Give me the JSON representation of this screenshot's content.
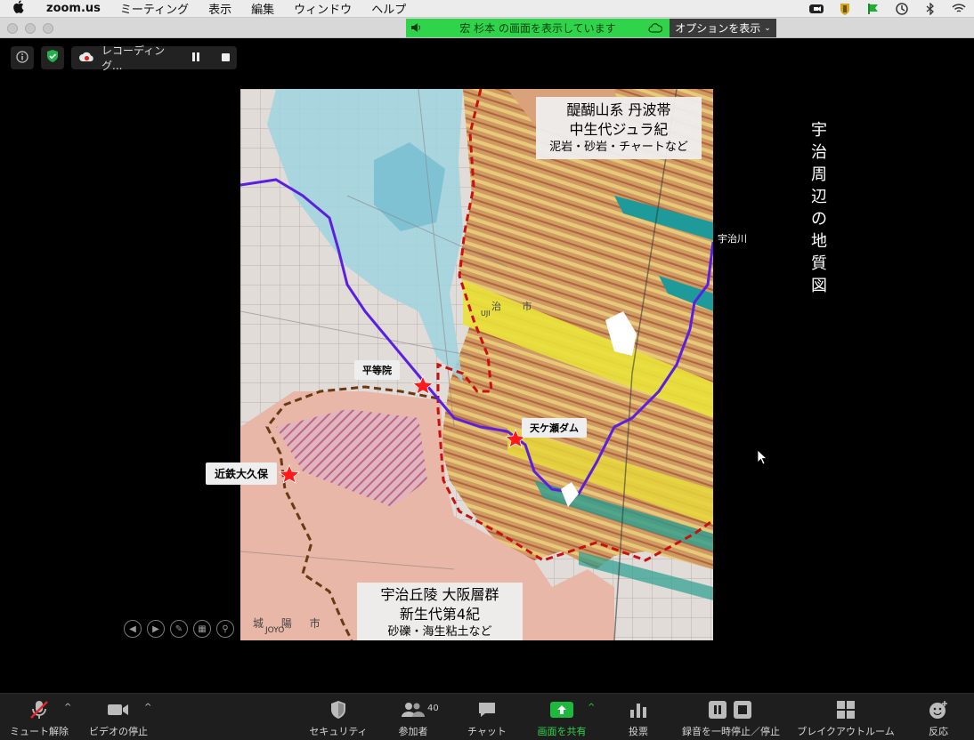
{
  "menubar": {
    "app": "zoom.us",
    "items": [
      "ミーティング",
      "表示",
      "編集",
      "ウィンドウ",
      "ヘルプ"
    ]
  },
  "share_bar": {
    "status": "宏 杉本 の画面を表示しています",
    "options": "オプションを表示"
  },
  "recording": {
    "label": "レコーディング..."
  },
  "slide": {
    "side_title": "宇治周辺の地質図",
    "box_top": [
      "醍醐山系 丹波帯",
      "中生代ジュラ紀",
      "泥岩・砂岩・チャートなど"
    ],
    "box_bottom": [
      "宇治丘陵 大阪層群",
      "新生代第4紀",
      "砂礫・海生粘土など"
    ],
    "river_label": "宇治川",
    "labels": {
      "byodoin": "平等院",
      "dam": "天ケ瀬ダム",
      "kintetsu": "近鉄大久保"
    },
    "map_text": {
      "uji": "UJI",
      "joyo": "JOYO",
      "city_joyo": "城 陽 市",
      "city_uji": "治 市"
    }
  },
  "toolbar": {
    "mute": "ミュート解除",
    "video": "ビデオの停止",
    "security": "セキュリティ",
    "participants": "参加者",
    "participant_count": "40",
    "chat": "チャット",
    "share": "画面を共有",
    "poll": "投票",
    "record": "録音を一時停止／停止",
    "breakout": "ブレイクアウトルーム",
    "reactions": "反応"
  },
  "colors": {
    "share_green": "#2fd44a",
    "river": "#5a1fe0",
    "border_red": "#c81010",
    "border_brown": "#6b3a12"
  }
}
